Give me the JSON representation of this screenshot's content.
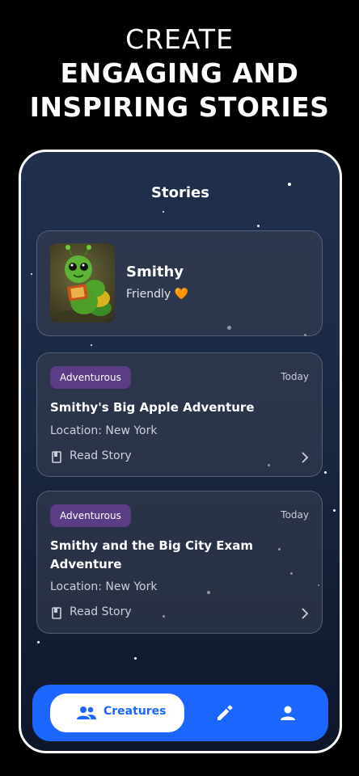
{
  "headline": {
    "line1": "CREATE",
    "line2": "ENGAGING AND",
    "line3": "INSPIRING STORIES"
  },
  "screen": {
    "title": "Stories"
  },
  "creature": {
    "name": "Smithy",
    "trait": "Friendly 🧡",
    "avatar_icon": "caterpillar-reading-image"
  },
  "stories": [
    {
      "tag": "Adventurous",
      "date": "Today",
      "title": "Smithy's Big Apple Adventure",
      "location": "Location: New York",
      "action": "Read Story"
    },
    {
      "tag": "Adventurous",
      "date": "Today",
      "title": "Smithy and the Big City Exam Adventure",
      "location": "Location: New York",
      "action": "Read Story"
    }
  ],
  "nav": {
    "creatures_label": "Creatures",
    "items": [
      "people-icon",
      "pencil-icon",
      "person-icon"
    ]
  },
  "colors": {
    "accent": "#1a66ff",
    "badge": "#5a3d84",
    "background": "#1a2842"
  }
}
